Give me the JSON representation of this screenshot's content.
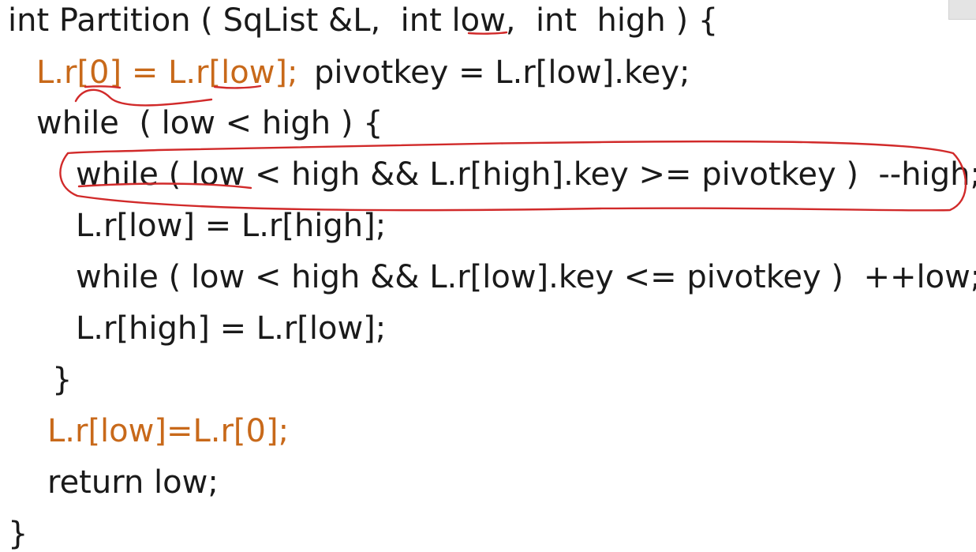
{
  "code": {
    "line1": "int Partition ( SqList &L,  int low,  int  high ) {",
    "line2a": "L.r[0] = L.r[low];",
    "line2b": "pivotkey = L.r[low].key;",
    "line3": "while  ( low < high ) {",
    "line4": "while ( low < high && L.r[high].key >= pivotkey )  --high;",
    "line5": "L.r[low] = L.r[high];",
    "line6": "while ( low < high && L.r[low].key <= pivotkey )  ++low;",
    "line7": "L.r[high] = L.r[low];",
    "line8": "}",
    "line9": "L.r[low]=L.r[0];",
    "line10": "return low;",
    "line11": "}"
  },
  "colors": {
    "text": "#1a1a1a",
    "highlight": "#c8691a",
    "annotation": "#d12a2a"
  }
}
